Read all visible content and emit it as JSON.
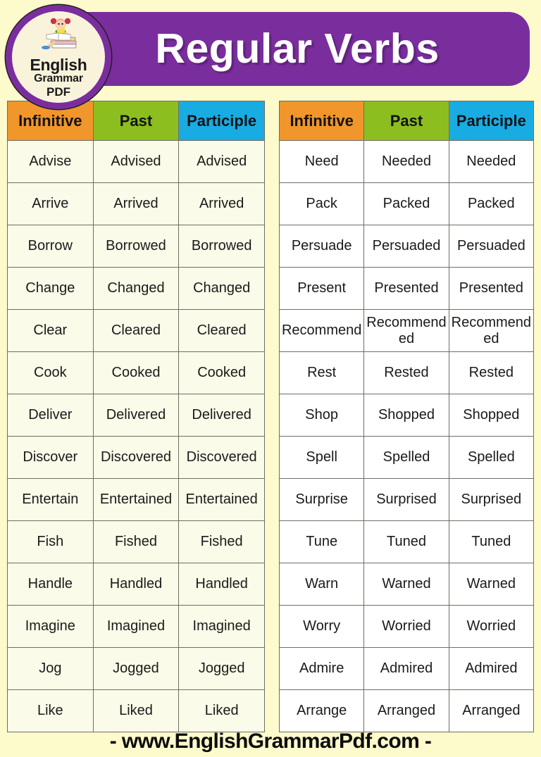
{
  "header": {
    "title": "Regular Verbs",
    "banner_color": "#7a2e9e"
  },
  "logo": {
    "line1": "English",
    "line2": "Grammar",
    "line3": "PDF",
    "icon": "girl-reading-books-icon",
    "ring_color": "#7a2e9e",
    "face_color": "#faf3dc"
  },
  "watermark": {
    "line1": "English",
    "line2": "Grammar",
    "line3": "PDF",
    "ring_color": "#c4afda"
  },
  "colors": {
    "page_background": "#fdfacb",
    "header_infinitive": "#f0962b",
    "header_past": "#8dbe1f",
    "header_participle": "#18ace3",
    "left_cell_background": "#fbfbe9",
    "right_cell_background": "#ffffff",
    "grid_line": "#6e6e64"
  },
  "columns": [
    "Infinitive",
    "Past",
    "Participle"
  ],
  "chart_data": {
    "type": "table",
    "title": "Regular Verbs",
    "columns": [
      "Infinitive",
      "Past",
      "Participle"
    ]
  },
  "table_left": {
    "headers": [
      "Infinitive",
      "Past",
      "Participle"
    ],
    "rows": [
      [
        "Advise",
        "Advised",
        "Advised"
      ],
      [
        "Arrive",
        "Arrived",
        "Arrived"
      ],
      [
        "Borrow",
        "Borrowed",
        "Borrowed"
      ],
      [
        "Change",
        "Changed",
        "Changed"
      ],
      [
        "Clear",
        "Cleared",
        "Cleared"
      ],
      [
        "Cook",
        "Cooked",
        "Cooked"
      ],
      [
        "Deliver",
        "Delivered",
        "Delivered"
      ],
      [
        "Discover",
        "Discovered",
        "Discovered"
      ],
      [
        "Entertain",
        "Entertained",
        "Entertained"
      ],
      [
        "Fish",
        "Fished",
        "Fished"
      ],
      [
        "Handle",
        "Handled",
        "Handled"
      ],
      [
        "Imagine",
        "Imagined",
        "Imagined"
      ],
      [
        "Jog",
        "Jogged",
        "Jogged"
      ],
      [
        "Like",
        "Liked",
        "Liked"
      ]
    ]
  },
  "table_right": {
    "headers": [
      "Infinitive",
      "Past",
      "Participle"
    ],
    "rows": [
      [
        "Need",
        "Needed",
        "Needed"
      ],
      [
        "Pack",
        "Packed",
        "Packed"
      ],
      [
        "Persuade",
        "Persuaded",
        "Persuaded"
      ],
      [
        "Present",
        "Presented",
        "Presented"
      ],
      [
        "Recommend",
        "Recommended",
        "Recommended"
      ],
      [
        "Rest",
        "Rested",
        "Rested"
      ],
      [
        "Shop",
        "Shopped",
        "Shopped"
      ],
      [
        "Spell",
        "Spelled",
        "Spelled"
      ],
      [
        "Surprise",
        "Surprised",
        "Surprised"
      ],
      [
        "Tune",
        "Tuned",
        "Tuned"
      ],
      [
        "Warn",
        "Warned",
        "Warned"
      ],
      [
        "Worry",
        "Worried",
        "Worried"
      ],
      [
        "Admire",
        "Admired",
        "Admired"
      ],
      [
        "Arrange",
        "Arranged",
        "Arranged"
      ]
    ]
  },
  "footer": {
    "text": "- www.EnglishGrammarPdf.com -"
  }
}
